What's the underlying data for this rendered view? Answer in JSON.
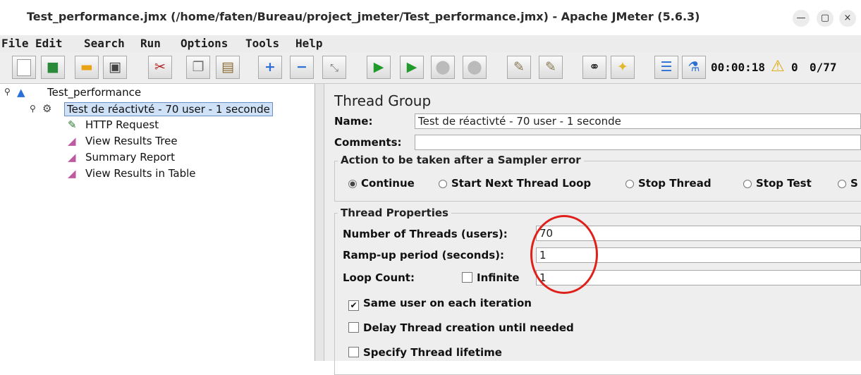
{
  "window": {
    "title": "Test_performance.jmx (/home/faten/Bureau/project_jmeter/Test_performance.jmx) - Apache JMeter (5.6.3)",
    "min_glyph": "—",
    "max_glyph": "▢",
    "close_glyph": "×"
  },
  "menu": {
    "items": [
      "File",
      "Edit",
      "Search",
      "Run",
      "Options",
      "Tools",
      "Help"
    ]
  },
  "toolbar": {
    "icons": [
      "new-icon",
      "templates-icon",
      "open-icon",
      "save-icon",
      "cut-icon",
      "copy-icon",
      "paste-icon",
      "expand-icon",
      "collapse-icon",
      "toggle-icon",
      "start-icon",
      "start-no-pause-icon",
      "stop-icon",
      "shutdown-icon",
      "clear-icon",
      "clear-all-icon",
      "search-icon",
      "reset-search-icon",
      "function-helper-icon",
      "help-icon"
    ],
    "elapsed": "00:00:18",
    "error_count": "0",
    "threads": "0/77"
  },
  "tree": {
    "nodes": [
      "Test_performance",
      "Test de réactivté - 70 user - 1 seconde",
      "HTTP Request",
      "View Results Tree",
      "Summary Report",
      "View Results in Table"
    ]
  },
  "panel": {
    "title": "Thread Group",
    "name_label": "Name:",
    "name_value": "Test de réactivté - 70 user - 1 seconde",
    "comments_label": "Comments:",
    "comments_value": "",
    "sampler_error_legend": "Action to be taken after a Sampler error",
    "radios": [
      "Continue",
      "Start Next Thread Loop",
      "Stop Thread",
      "Stop Test",
      "S"
    ],
    "thread_props_legend": "Thread Properties",
    "threads_label": "Number of Threads (users):",
    "threads_value": "70",
    "rampup_label": "Ramp-up period (seconds):",
    "rampup_value": "1",
    "loop_label": "Loop Count:",
    "infinite_label": "Infinite",
    "loop_value": "1",
    "same_user_label": "Same user on each iteration",
    "delay_label": "Delay Thread creation until needed",
    "lifetime_label": "Specify Thread lifetime"
  }
}
